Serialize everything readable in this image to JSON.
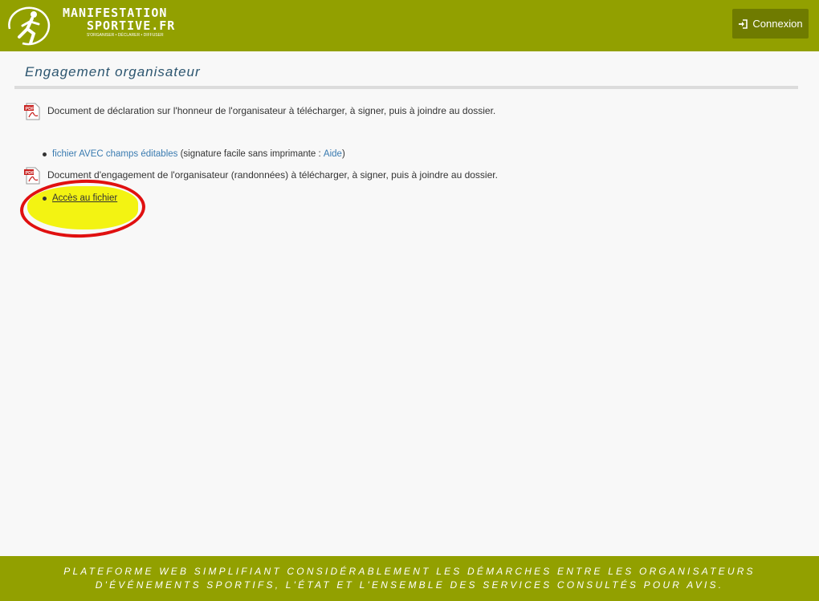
{
  "header": {
    "logo_line1": "MANIFESTATION",
    "logo_line2": "SPORTIVE.FR",
    "logo_tagline": "S'ORGANISER • DÉCLARER • DIFFUSER",
    "login_label": "Connexion",
    "bg_color": "#92a000",
    "button_color": "#6f7b00"
  },
  "page": {
    "title": "Engagement organisateur"
  },
  "documents": [
    {
      "text": "Document de déclaration sur l'honneur de l'organisateur à télécharger, à signer, puis à joindre au dossier.",
      "link_text": "fichier AVEC champs éditables",
      "link_suffix": " (signature facile sans imprimante : ",
      "help_link": "Aide",
      "closing": ")"
    },
    {
      "text": "Document d'engagement de l'organisateur (randonnées) à télécharger, à signer, puis à joindre au dossier.",
      "link_text": "Accès au fichier"
    }
  ],
  "footer": {
    "line1": "PLATEFORME WEB SIMPLIFIANT CONSIDÉRABLEMENT LES DÉMARCHES ENTRE LES ORGANISATEURS",
    "line2": "D'ÉVÉNEMENTS SPORTIFS, L'ÉTAT ET L'ENSEMBLE DES SERVICES CONSULTÉS POUR AVIS."
  },
  "annotation": {
    "highlight_color": "#f3f312",
    "circle_color": "#e01010"
  }
}
